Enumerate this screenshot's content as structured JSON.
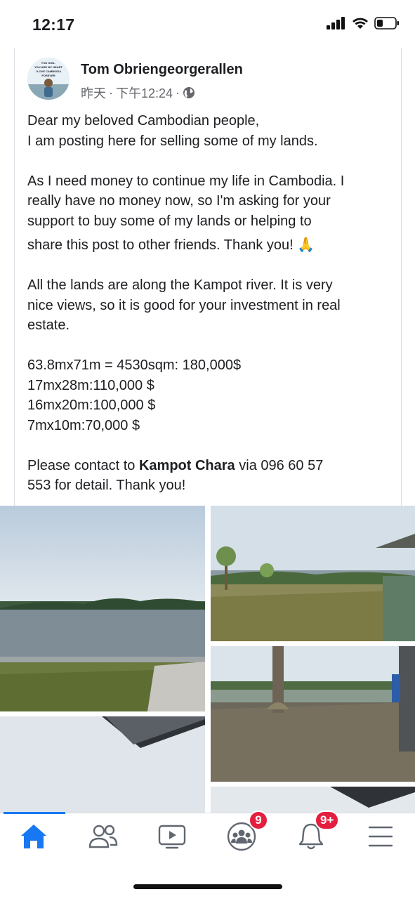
{
  "status_bar": {
    "time": "12:17"
  },
  "post": {
    "author": "Tom Obriengeorgerallen",
    "date": "昨天",
    "separator": "·",
    "time": "下午12:24",
    "separator2": "·",
    "audience_icon": "globe-icon",
    "avatar_text": [
      "YOU SON..",
      "YOU ARE MY HEART",
      "I LOVE CAMBODIA",
      "FOREVER"
    ],
    "lines": {
      "l1": "Dear my beloved Cambodian people,",
      "l2": "I am posting here for selling some of my lands.",
      "l3": "As I need money to continue my life in Cambodia. I",
      "l4": "really have no money now, so I'm asking for your",
      "l5": "support to buy some of my lands or helping to",
      "l6": "share this post to other friends. Thank you!",
      "l6_emoji": "🙏",
      "l7": "All the lands are along the Kampot river. It is very",
      "l8": "nice views, so it is good for your investment in real",
      "l9": "estate.",
      "l10": "63.8mx71m =  4530sqm: 180,000$",
      "l11": "17mx28m:110,000 $",
      "l12": "16mx20m:100,000 $",
      "l13": "7mx10m:70,000 $",
      "l14_pre": "Please contact to ",
      "l14_bold": "Kampot Chara",
      "l14_post": " via 096 60 57",
      "l15": "553 for detail. Thank you!"
    }
  },
  "photos": [
    {
      "name": "photo-river-view"
    },
    {
      "name": "photo-riverbank-hut"
    },
    {
      "name": "photo-palm-lot"
    },
    {
      "name": "photo-sky-roof"
    },
    {
      "name": "photo-more"
    }
  ],
  "tab_bar": {
    "tabs": [
      {
        "name": "home",
        "icon": "home-icon",
        "active": true
      },
      {
        "name": "friends",
        "icon": "friends-icon"
      },
      {
        "name": "watch",
        "icon": "video-icon"
      },
      {
        "name": "groups",
        "icon": "groups-icon",
        "badge": "9"
      },
      {
        "name": "notifications",
        "icon": "bell-icon",
        "badge": "9+"
      },
      {
        "name": "menu",
        "icon": "menu-icon"
      }
    ]
  },
  "colors": {
    "accent": "#1877f2",
    "badge": "#e41e3f",
    "text": "#1c1e21",
    "muted": "#65676b"
  }
}
